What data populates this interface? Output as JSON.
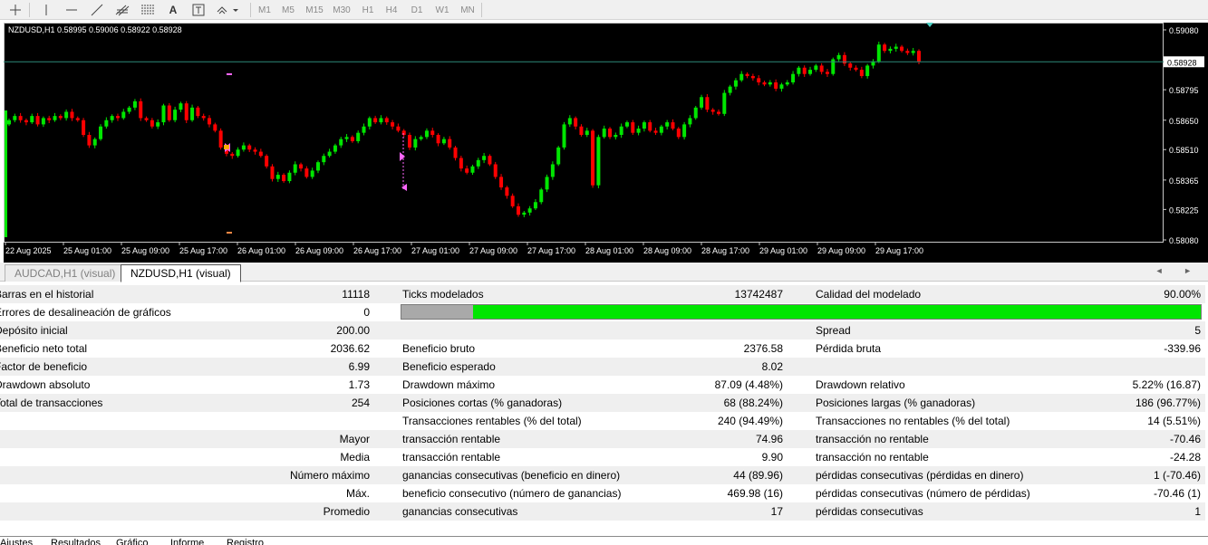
{
  "toolbar": {
    "tools": [
      "crosshair-icon",
      "vertical-line-icon",
      "horizontal-line-icon",
      "trend-line-icon",
      "fibonacci-icon",
      "equidistant-channel-icon",
      "text-icon",
      "text-label-icon",
      "arrows-icon"
    ],
    "text_tool_label": "A",
    "timeframes": [
      "M1",
      "M5",
      "M15",
      "M30",
      "H1",
      "H4",
      "D1",
      "W1",
      "MN"
    ]
  },
  "chart": {
    "header": "NZDUSD,H1  0.58995 0.59006 0.58922 0.58928",
    "current_price_label": "0.58928",
    "colors": {
      "background": "#000000",
      "bull": "#00e600",
      "bear": "#ff0000",
      "axis_text": "#ffffff",
      "price_line": "#2e8b7a"
    },
    "chart_data": {
      "type": "candlestick",
      "symbol": "NZDUSD",
      "timeframe": "H1",
      "y_ticks": [
        "0.59080",
        "0.58795",
        "0.58650",
        "0.58510",
        "0.58365",
        "0.58225",
        "0.58080"
      ],
      "ylim": [
        0.5808,
        0.5908
      ],
      "x_ticks": [
        "22 Aug 2025",
        "25 Aug 01:00",
        "25 Aug 09:00",
        "25 Aug 17:00",
        "26 Aug 01:00",
        "26 Aug 09:00",
        "26 Aug 17:00",
        "27 Aug 01:00",
        "27 Aug 09:00",
        "27 Aug 17:00",
        "28 Aug 01:00",
        "28 Aug 09:00",
        "28 Aug 17:00",
        "29 Aug 01:00",
        "29 Aug 09:00",
        "29 Aug 17:00"
      ],
      "last_price": 0.58928,
      "closes": [
        0.5865,
        0.5867,
        0.5865,
        0.5864,
        0.5867,
        0.5863,
        0.5866,
        0.5865,
        0.5867,
        0.5866,
        0.5869,
        0.5866,
        0.5865,
        0.5858,
        0.5853,
        0.5856,
        0.5862,
        0.5865,
        0.5867,
        0.5866,
        0.5869,
        0.5871,
        0.5874,
        0.5866,
        0.5865,
        0.5862,
        0.5864,
        0.5872,
        0.5865,
        0.587,
        0.5873,
        0.5865,
        0.5871,
        0.5867,
        0.5866,
        0.5863,
        0.586,
        0.5852,
        0.5849,
        0.5848,
        0.5851,
        0.5853,
        0.5851,
        0.585,
        0.5848,
        0.5843,
        0.5837,
        0.5839,
        0.5836,
        0.584,
        0.5844,
        0.5842,
        0.5838,
        0.5841,
        0.5845,
        0.5848,
        0.585,
        0.5853,
        0.5856,
        0.5857,
        0.5855,
        0.5859,
        0.5862,
        0.5866,
        0.5864,
        0.5866,
        0.5864,
        0.5862,
        0.586,
        0.5858,
        0.5852,
        0.5856,
        0.5857,
        0.586,
        0.5858,
        0.5854,
        0.5856,
        0.5852,
        0.5847,
        0.5842,
        0.584,
        0.5843,
        0.5846,
        0.5848,
        0.5844,
        0.5838,
        0.5833,
        0.5829,
        0.5824,
        0.582,
        0.5821,
        0.5823,
        0.5826,
        0.5832,
        0.5838,
        0.5844,
        0.5852,
        0.5863,
        0.5866,
        0.5862,
        0.5858,
        0.586,
        0.5834,
        0.5857,
        0.5861,
        0.5857,
        0.5858,
        0.5862,
        0.5864,
        0.5859,
        0.5861,
        0.5864,
        0.586,
        0.5859,
        0.5862,
        0.5864,
        0.5861,
        0.5857,
        0.5863,
        0.5866,
        0.5871,
        0.5876,
        0.587,
        0.5869,
        0.5868,
        0.5878,
        0.5881,
        0.5884,
        0.5887,
        0.5886,
        0.5885,
        0.5883,
        0.5882,
        0.5883,
        0.588,
        0.5882,
        0.5883,
        0.5887,
        0.589,
        0.5887,
        0.5889,
        0.5891,
        0.5888,
        0.5887,
        0.5894,
        0.5896,
        0.5892,
        0.589,
        0.5889,
        0.5886,
        0.5891,
        0.5893,
        0.5901,
        0.5898,
        0.5899,
        0.59,
        0.5898,
        0.5897,
        0.5898,
        0.5893
      ]
    }
  },
  "tabs": [
    {
      "label": "AUDCAD,H1 (visual)",
      "active": false
    },
    {
      "label": "NZDUSD,H1 (visual)",
      "active": true
    }
  ],
  "report": {
    "rows": [
      [
        "Barras en el historial",
        "11118",
        "Ticks modelados",
        "13742487",
        "Calidad del modelado",
        "90.00%"
      ],
      [
        "Errores de desalineación de gráficos",
        "0",
        "",
        "",
        "",
        ""
      ],
      [
        "Depósito inicial",
        "200.00",
        "",
        "",
        "Spread",
        "5"
      ],
      [
        "Beneficio neto total",
        "2036.62",
        "Beneficio bruto",
        "2376.58",
        "Pérdida bruta",
        "-339.96"
      ],
      [
        "Factor de beneficio",
        "6.99",
        "Beneficio esperado",
        "8.02",
        "",
        ""
      ],
      [
        "Drawdown absoluto",
        "1.73",
        "Drawdown máximo",
        "87.09 (4.48%)",
        "Drawdown relativo",
        "5.22% (16.87)"
      ],
      [
        "Total de transacciones",
        "254",
        "Posiciones cortas (% ganadoras)",
        "68 (88.24%)",
        "Posiciones largas (% ganadoras)",
        "186 (96.77%)"
      ],
      [
        "",
        "",
        "Transacciones rentables (% del total)",
        "240 (94.49%)",
        "Transacciones no rentables (% del total)",
        "14 (5.51%)"
      ],
      [
        "",
        "Mayor",
        "transacción rentable",
        "74.96",
        "transacción no rentable",
        "-70.46"
      ],
      [
        "",
        "Media",
        "transacción rentable",
        "9.90",
        "transacción no rentable",
        "-24.28"
      ],
      [
        "",
        "Número máximo",
        "ganancias consecutivas (beneficio en dinero)",
        "44 (89.96)",
        "pérdidas consecutivas (pérdidas en dinero)",
        "1 (-70.46)"
      ],
      [
        "",
        "Máx.",
        "beneficio consecutivo (número de ganancias)",
        "469.98 (16)",
        "pérdidas consecutivas (número de pérdidas)",
        "-70.46 (1)"
      ],
      [
        "",
        "Promedio",
        "ganancias consecutivas",
        "17",
        "pérdidas consecutivas",
        "1"
      ]
    ],
    "modeling_quality": 0.09
  },
  "bottom_tabs": [
    "Ajustes",
    "Resultados",
    "Gráfico",
    "Informe",
    "Registro"
  ]
}
